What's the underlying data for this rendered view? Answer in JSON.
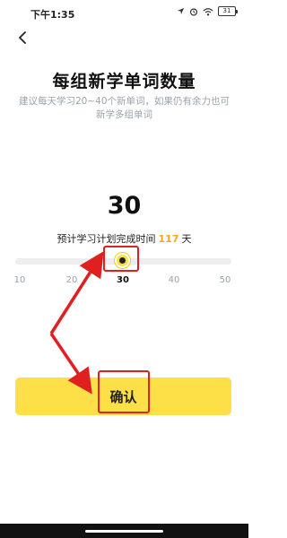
{
  "status_bar": {
    "time": "下午1:35",
    "battery": "31"
  },
  "header": {
    "back_icon": "chevron-left-icon",
    "title": "每组新学单词数量",
    "subtitle": "建议每天学习20~40个新单词，如果仍有余力也可新学多组单词"
  },
  "selector": {
    "value": "30",
    "estimate_prefix": "预计学习计划完成时间",
    "estimate_days": "117",
    "estimate_unit": "天",
    "min": 10,
    "max": 50,
    "ticks": [
      "10",
      "20",
      "30",
      "40",
      "50"
    ],
    "selected_tick": "30"
  },
  "actions": {
    "confirm_label": "确认"
  },
  "colors": {
    "accent": "#fde047",
    "highlight_days": "#f5a623",
    "annotation_red": "#e02020"
  }
}
